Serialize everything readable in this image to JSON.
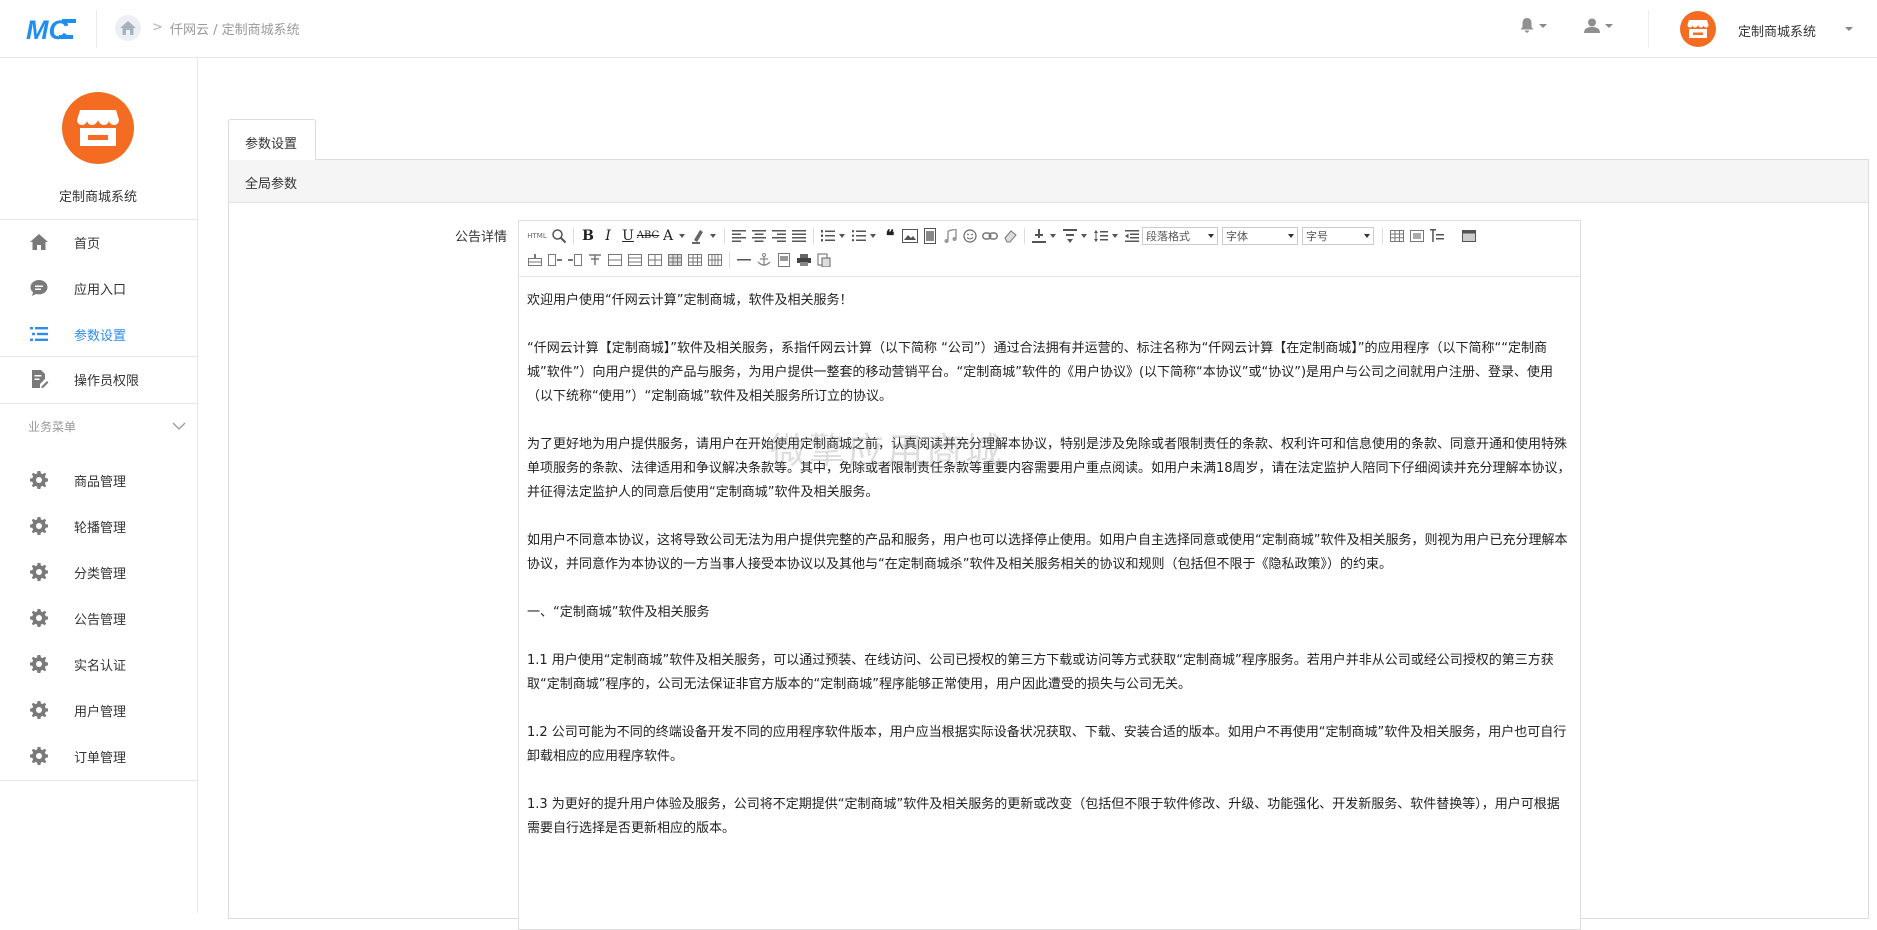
{
  "header": {
    "breadcrumb": "仟网云 / 定制商城系统",
    "app_name": "定制商城系统"
  },
  "sidebar": {
    "brand_name": "定制商城系统",
    "items": [
      {
        "label": "首页",
        "icon": "home-icon"
      },
      {
        "label": "应用入口",
        "icon": "chat-icon"
      },
      {
        "label": "参数设置",
        "icon": "list-icon",
        "active": true
      },
      {
        "label": "操作员权限",
        "icon": "edit-doc-icon"
      }
    ],
    "section_title": "业务菜单",
    "business_items": [
      {
        "label": "商品管理",
        "icon": "gear-icon"
      },
      {
        "label": "轮播管理",
        "icon": "gear-icon"
      },
      {
        "label": "分类管理",
        "icon": "gear-icon"
      },
      {
        "label": "公告管理",
        "icon": "gear-icon"
      },
      {
        "label": "实名认证",
        "icon": "gear-icon"
      },
      {
        "label": "用户管理",
        "icon": "gear-icon"
      },
      {
        "label": "订单管理",
        "icon": "gear-icon"
      }
    ]
  },
  "main": {
    "tab_label": "参数设置",
    "panel_title": "全局参数",
    "field_label": "公告详情",
    "toolbar": {
      "html_label": "HTML",
      "paragraph_format": "段落格式",
      "font_family": "字体",
      "font_size": "字号"
    },
    "content": [
      "欢迎用户使用“仟网云计算”定制商城，软件及相关服务！",
      "“仟网云计算【定制商城】”软件及相关服务，系指仟网云计算（以下简称 “公司”）通过合法拥有并运营的、标注名称为“仟网云计算【在定制商城】”的应用程序（以下简称““定制商城”软件”）向用户提供的产品与服务，为用户提供一整套的移动营销平台。“定制商城”软件的《用户协议》(以下简称“本协议”或“协议”)是用户与公司之间就用户注册、登录、使用（以下统称“使用”）“定制商城”软件及相关服务所订立的协议。",
      "为了更好地为用户提供服务，请用户在开始使用定制商城之前，认真阅读并充分理解本协议，特别是涉及免除或者限制责任的条款、权利许可和信息使用的条款、同意开通和使用特殊单项服务的条款、法律适用和争议解决条款等。其中，免除或者限制责任条款等重要内容需要用户重点阅读。如用户未满18周岁，请在法定监护人陪同下仔细阅读并充分理解本协议，并征得法定监护人的同意后使用“定制商城”软件及相关服务。",
      "如用户不同意本协议，这将导致公司无法为用户提供完整的产品和服务，用户也可以选择停止使用。如用户自主选择同意或使用“定制商城”软件及相关服务，则视为用户已充分理解本协议，并同意作为本协议的一方当事人接受本协议以及其他与“在定制商城杀”软件及相关服务相关的协议和规则（包括但不限于《隐私政策》）的约束。",
      "一、“定制商城”软件及相关服务",
      "1.1 用户使用“定制商城”软件及相关服务，可以通过预装、在线访问、公司已授权的第三方下载或访问等方式获取“定制商城”程序服务。若用户并非从公司或经公司授权的第三方获取“定制商城”程序的，公司无法保证非官方版本的“定制商城”程序能够正常使用，用户因此遭受的损失与公司无关。",
      "1.2 公司可能为不同的终端设备开发不同的应用程序软件版本，用户应当根据实际设备状况获取、下载、安装合适的版本。如用户不再使用“定制商城”软件及相关服务，用户也可自行卸载相应的应用程序软件。",
      "1.3 为更好的提升用户体验及服务，公司将不定期提供“定制商城”软件及相关服务的更新或改变（包括但不限于软件修改、升级、功能强化、开发新服务、软件替换等），用户可根据需要自行选择是否更新相应的版本。"
    ]
  },
  "watermark": "微擎应用商城",
  "colors": {
    "brand_orange": "#f36c21",
    "logo_blue": "#1e8ef0",
    "active_blue": "#2e8cf0"
  }
}
